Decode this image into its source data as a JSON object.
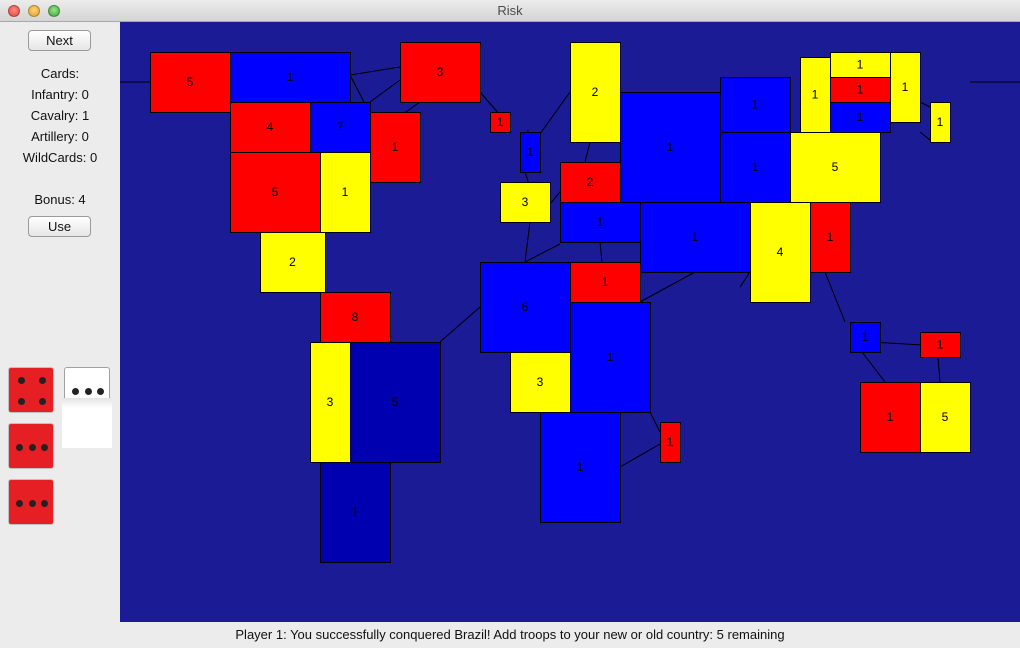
{
  "window": {
    "title": "Risk"
  },
  "sidebar": {
    "next_label": "Next",
    "cards_label": "Cards:",
    "infantry_text": "Infantry: 0",
    "cavalry_text": "Cavalry: 1",
    "artillery_text": "Artillery: 0",
    "wildcards_text": "WildCards: 0",
    "bonus_text": "Bonus: 4",
    "use_label": "Use"
  },
  "dice": {
    "attacker": [
      4,
      3,
      3
    ],
    "defender": [
      3
    ],
    "attacker_color": "#e51f24",
    "defender_color": "#ffffff"
  },
  "colors": {
    "red": "#ff0000",
    "yellow": "#ffff00",
    "blue": "#0000ff",
    "navy": "#0000b0",
    "ocean": "#1b1b96"
  },
  "territories": [
    {
      "color": "red",
      "troops": "5"
    },
    {
      "color": "blue",
      "troops": "1"
    },
    {
      "color": "red",
      "troops": "3"
    },
    {
      "color": "red",
      "troops": "4"
    },
    {
      "color": "blue",
      "troops": "7"
    },
    {
      "color": "red",
      "troops": "1"
    },
    {
      "color": "red",
      "troops": "5"
    },
    {
      "color": "yellow",
      "troops": "1"
    },
    {
      "color": "yellow",
      "troops": "2"
    },
    {
      "color": "red",
      "troops": "8"
    },
    {
      "color": "yellow",
      "troops": "3"
    },
    {
      "color": "navy",
      "troops": "5"
    },
    {
      "color": "navy",
      "troops": "1"
    },
    {
      "color": "red",
      "troops": "1"
    },
    {
      "color": "blue",
      "troops": "1"
    },
    {
      "color": "yellow",
      "troops": "2"
    },
    {
      "color": "yellow",
      "troops": "3"
    },
    {
      "color": "red",
      "troops": "2"
    },
    {
      "color": "blue",
      "troops": "1"
    },
    {
      "color": "blue",
      "troops": "6"
    },
    {
      "color": "red",
      "troops": "1"
    },
    {
      "color": "yellow",
      "troops": "3"
    },
    {
      "color": "blue",
      "troops": "1"
    },
    {
      "color": "blue",
      "troops": "1"
    },
    {
      "color": "red",
      "troops": "1"
    },
    {
      "color": "blue",
      "troops": "1"
    },
    {
      "color": "blue",
      "troops": "1"
    },
    {
      "color": "blue",
      "troops": "1"
    },
    {
      "color": "blue",
      "troops": "1"
    },
    {
      "color": "yellow",
      "troops": "1"
    },
    {
      "color": "yellow",
      "troops": "1"
    },
    {
      "color": "red",
      "troops": "1"
    },
    {
      "color": "blue",
      "troops": "1"
    },
    {
      "color": "yellow",
      "troops": "1"
    },
    {
      "color": "yellow",
      "troops": "1"
    },
    {
      "color": "yellow",
      "troops": "5"
    },
    {
      "color": "yellow",
      "troops": "4"
    },
    {
      "color": "red",
      "troops": "1"
    },
    {
      "color": "blue",
      "troops": "1"
    },
    {
      "color": "red",
      "troops": "1"
    },
    {
      "color": "red",
      "troops": "1"
    },
    {
      "color": "yellow",
      "troops": "5"
    }
  ],
  "status": {
    "message": "Player 1: You successfully conquered Brazil! Add troops to your new or old country: 5 remaining"
  }
}
